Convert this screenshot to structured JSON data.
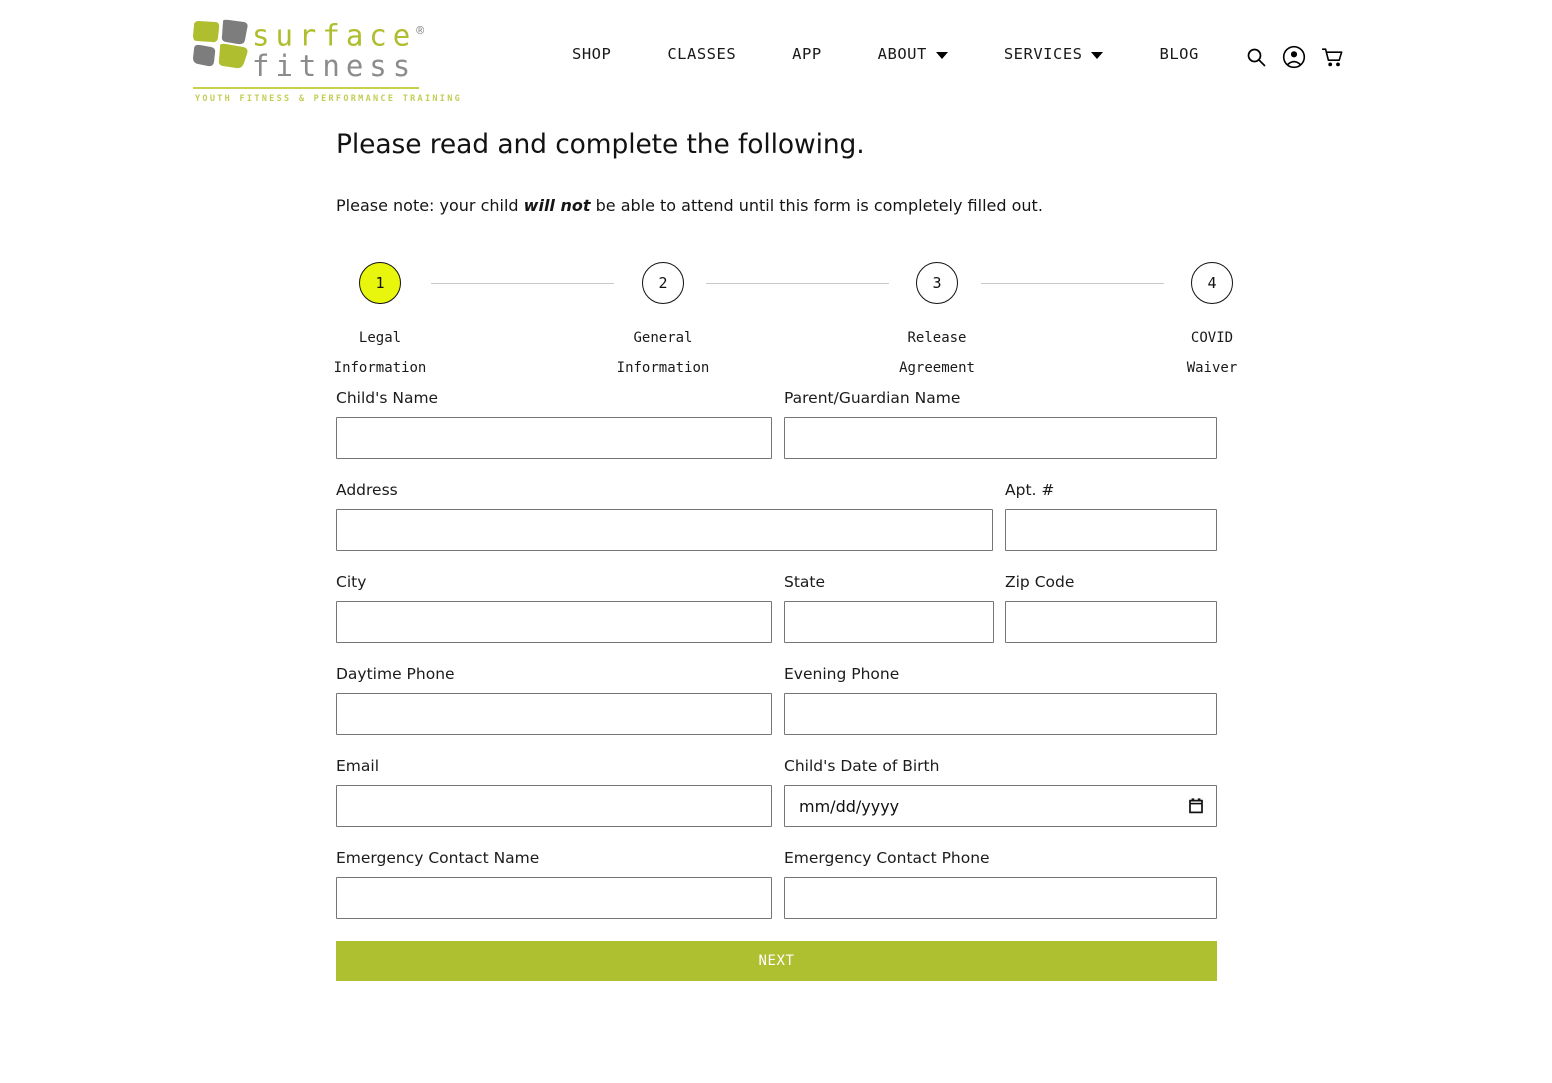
{
  "header": {
    "logo": {
      "word_primary": "surface",
      "word_secondary": "fitness",
      "registered_mark": "®",
      "tagline": "YOUTH FITNESS & PERFORMANCE TRAINING",
      "brand_green": "#AFBE2E",
      "brand_gray": "#8c8c8c"
    },
    "nav": [
      {
        "label": "SHOP",
        "has_dropdown": false
      },
      {
        "label": "CLASSES",
        "has_dropdown": false
      },
      {
        "label": "APP",
        "has_dropdown": false
      },
      {
        "label": "ABOUT",
        "has_dropdown": true
      },
      {
        "label": "SERVICES",
        "has_dropdown": true
      },
      {
        "label": "BLOG",
        "has_dropdown": false
      }
    ],
    "icons": [
      {
        "name": "search-icon"
      },
      {
        "name": "account-icon"
      },
      {
        "name": "cart-icon"
      }
    ]
  },
  "main": {
    "title": "Please read and complete the following.",
    "note_before": "Please note: your child ",
    "note_bold": "will not",
    "note_after": " be able to attend until this form is completely filled out."
  },
  "stepper": {
    "active_color": "#E8F50C",
    "steps": [
      {
        "number": "1",
        "label": "Legal\nInformation",
        "active": true
      },
      {
        "number": "2",
        "label": "General\nInformation",
        "active": false
      },
      {
        "number": "3",
        "label": "Release\nAgreement",
        "active": false
      },
      {
        "number": "4",
        "label": "COVID\nWaiver",
        "active": false
      }
    ]
  },
  "form": {
    "fields": {
      "child_name": {
        "label": "Child's Name",
        "value": "",
        "placeholder": ""
      },
      "parent_name": {
        "label": "Parent/Guardian Name",
        "value": "",
        "placeholder": ""
      },
      "address": {
        "label": "Address",
        "value": "",
        "placeholder": ""
      },
      "apt": {
        "label": "Apt. #",
        "value": "",
        "placeholder": ""
      },
      "city": {
        "label": "City",
        "value": "",
        "placeholder": ""
      },
      "state": {
        "label": "State",
        "value": "",
        "placeholder": ""
      },
      "zip": {
        "label": "Zip Code",
        "value": "",
        "placeholder": ""
      },
      "daytime_phone": {
        "label": "Daytime Phone",
        "value": "",
        "placeholder": ""
      },
      "evening_phone": {
        "label": "Evening Phone",
        "value": "",
        "placeholder": ""
      },
      "email": {
        "label": "Email",
        "value": "",
        "placeholder": ""
      },
      "dob": {
        "label": "Child's Date of Birth",
        "value": "",
        "placeholder": "mm/dd/yyyy"
      },
      "emergency_name": {
        "label": "Emergency Contact Name",
        "value": "",
        "placeholder": ""
      },
      "emergency_phone": {
        "label": "Emergency Contact Phone",
        "value": "",
        "placeholder": ""
      }
    },
    "submit_label": "NEXT",
    "submit_color": "#AEBF2F"
  }
}
